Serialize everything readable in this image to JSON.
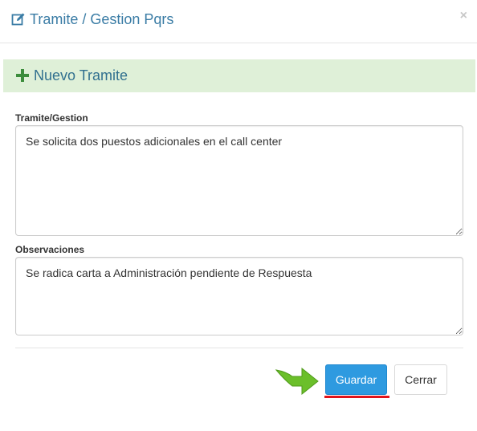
{
  "header": {
    "title": "Tramite / Gestion Pqrs",
    "close_symbol": "×",
    "title_icon": "edit-icon"
  },
  "section": {
    "title": "Nuevo Tramite",
    "icon": "plus-icon"
  },
  "form": {
    "tramite_label": "Tramite/Gestion",
    "tramite_value": "Se solicita dos puestos adicionales en el call center",
    "observaciones_label": "Observaciones",
    "observaciones_value": "Se radica carta a Administración pendiente de Respuesta"
  },
  "footer": {
    "save_label": "Guardar",
    "close_label": "Cerrar"
  },
  "colors": {
    "title": "#3a7ca5",
    "banner_bg": "#dff0d8",
    "banner_text": "#31708f",
    "primary_button": "#2e9ae0",
    "highlight_underline": "#e0141c",
    "arrow": "#6bbf2a"
  }
}
